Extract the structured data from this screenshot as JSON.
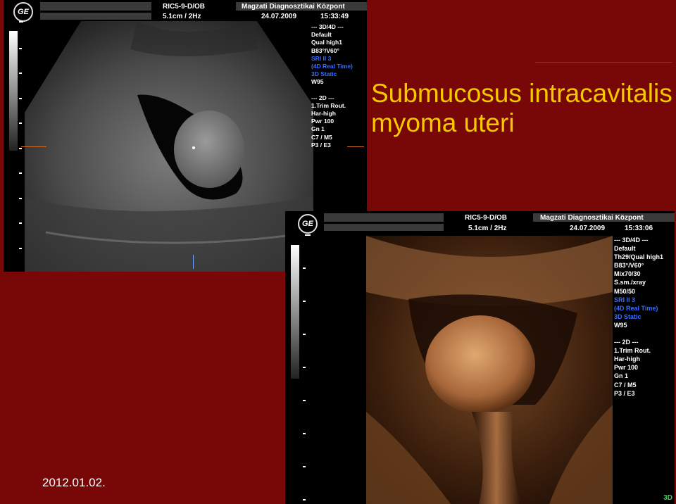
{
  "slide": {
    "title_line1": "Submucosus intracavitalis",
    "title_line2": "myoma uteri",
    "date": "2012.01.02.",
    "title_color": "#f5c800",
    "background_color": "#780808"
  },
  "panel1": {
    "logo": "GE",
    "probe": "RIC5-9-D/OB",
    "institution": "Magzati Diagnosztikai Központ",
    "depth_rate": "5.1cm / 2Hz",
    "date": "24.07.2009",
    "time": "15:33:49",
    "params": [
      "--- 3D/4D ---",
      "Default",
      "Qual high1",
      "B83°/V60°",
      "SRI II 3",
      "(4D Real Time)",
      "3D Static",
      "W95",
      "",
      "--- 2D ---",
      "1.Trim Rout.",
      "Har-high",
      "Pwr 100",
      "Gn  1",
      "C7 / M5",
      "P3 / E3"
    ],
    "blue_params": [
      "SRI II 3",
      "(4D Real Time)",
      "3D Static"
    ],
    "image_icon": "grayscale-ultrasound-image"
  },
  "panel2": {
    "logo": "GE",
    "probe": "RIC5-9-D/OB",
    "institution": "Magzati Diagnosztikai Központ",
    "depth_rate": "5.1cm / 2Hz",
    "date": "24.07.2009",
    "time": "15:33:06",
    "params": [
      "--- 3D/4D ---",
      "Default",
      "Th29/Qual high1",
      "B83°/V60°",
      "Mix70/30",
      "S.sm./xray",
      "M50/50",
      "SRI II 3",
      "(4D Real Time)",
      "3D Static",
      "W95",
      "",
      "--- 2D ---",
      "1.Trim Rout.",
      "Har-high",
      "Pwr 100",
      "Gn  1",
      "C7 / M5",
      "P3 / E3"
    ],
    "blue_params": [
      "SRI II 3",
      "(4D Real Time)",
      "3D Static"
    ],
    "mode_tag": "3D",
    "image_icon": "3d-rendered-ultrasound-image"
  }
}
